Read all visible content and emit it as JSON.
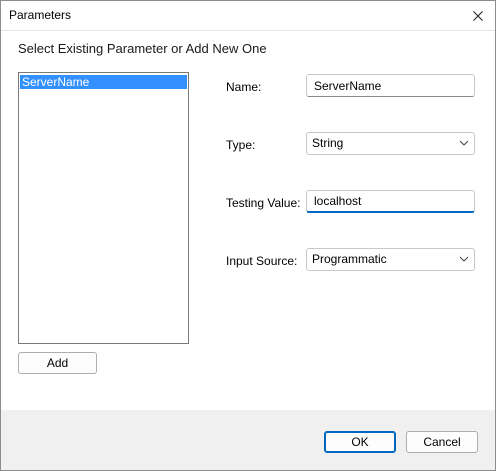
{
  "window": {
    "title": "Parameters"
  },
  "heading": "Select Existing Parameter or Add New One",
  "parameters": {
    "items": [
      "ServerName"
    ],
    "selected": "ServerName"
  },
  "add_label": "Add",
  "form": {
    "name_label": "Name:",
    "name_value": "ServerName",
    "type_label": "Type:",
    "type_value": "String",
    "testing_label": "Testing Value:",
    "testing_value": "localhost",
    "source_label": "Input Source:",
    "source_value": "Programmatic"
  },
  "buttons": {
    "ok": "OK",
    "cancel": "Cancel"
  },
  "icons": {
    "close": "close-icon",
    "dropdown": "chevron-down-icon"
  },
  "colors": {
    "selection": "#3390ff",
    "accent": "#0067c0"
  }
}
